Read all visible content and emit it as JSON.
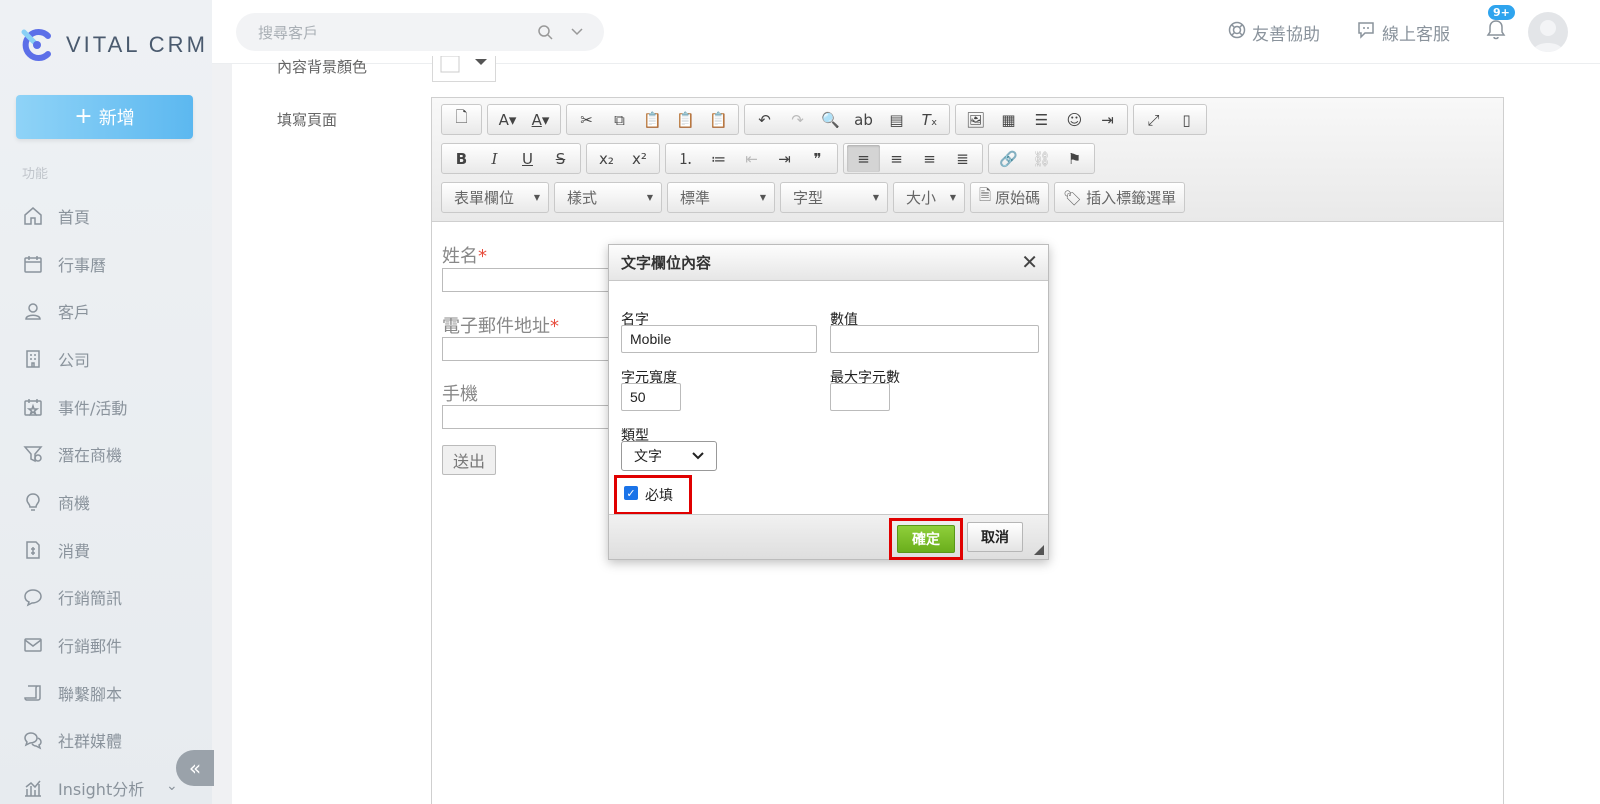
{
  "brand": {
    "name": "VITAL CRM"
  },
  "sidebar": {
    "new_button": "新增",
    "section_label": "功能",
    "items": [
      {
        "label": "首頁",
        "icon": "home-icon"
      },
      {
        "label": "行事曆",
        "icon": "calendar-icon"
      },
      {
        "label": "客戶",
        "icon": "customer-icon"
      },
      {
        "label": "公司",
        "icon": "building-icon"
      },
      {
        "label": "事件/活動",
        "icon": "event-icon"
      },
      {
        "label": "潛在商機",
        "icon": "funnel-icon"
      },
      {
        "label": "商機",
        "icon": "bulb-icon"
      },
      {
        "label": "消費",
        "icon": "receipt-icon"
      },
      {
        "label": "行銷簡訊",
        "icon": "sms-icon"
      },
      {
        "label": "行銷郵件",
        "icon": "mail-icon"
      },
      {
        "label": "聯繫腳本",
        "icon": "script-icon"
      },
      {
        "label": "社群媒體",
        "icon": "chat-icon"
      },
      {
        "label": "Insight分析",
        "icon": "chart-icon"
      }
    ],
    "collapse": "«"
  },
  "topbar": {
    "search_placeholder": "搜尋客戶",
    "help": "友善協助",
    "support": "線上客服",
    "notif_badge": "9+"
  },
  "page": {
    "bg_color_label": "內容背景顏色",
    "fill_page_label": "填寫頁面"
  },
  "toolbar": {
    "combos": [
      "表單欄位",
      "樣式",
      "標準",
      "字型",
      "大小"
    ],
    "source_button": "原始碼",
    "insert_tag_button": "插入標籤選單"
  },
  "form_preview": {
    "name_label": "姓名",
    "email_label": "電子郵件地址",
    "mobile_label": "手機",
    "required_mark": "*",
    "submit": "送出"
  },
  "dialog": {
    "title": "文字欄位內容",
    "name_label": "名字",
    "name_value": "Mobile",
    "value_label": "數值",
    "value_value": "",
    "width_label": "字元寬度",
    "width_value": "50",
    "maxlen_label": "最大字元數",
    "maxlen_value": "",
    "type_label": "類型",
    "type_value": "文字",
    "required_label": "必填",
    "required_checked": true,
    "ok": "確定",
    "cancel": "取消"
  },
  "colors": {
    "accent": "#5cb8f0",
    "ok_green": "#6aae1c",
    "highlight_red": "#e00000",
    "badge_blue": "#2fa4ee"
  }
}
